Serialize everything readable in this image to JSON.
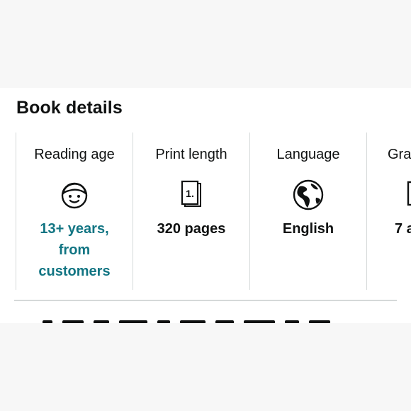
{
  "section": {
    "title": "Book details"
  },
  "details": [
    {
      "label": "Reading age",
      "icon": "child-face-icon",
      "value": "13+ years, from customers",
      "value_link": true
    },
    {
      "label": "Print length",
      "icon": "pages-icon",
      "icon_text": "1.",
      "value": "320 pages",
      "value_link": false
    },
    {
      "label": "Language",
      "icon": "globe-icon",
      "value": "English",
      "value_link": false
    },
    {
      "label": "Gra",
      "icon": "grade-icon",
      "value": "7 a",
      "value_link": false
    }
  ],
  "colors": {
    "link": "#127583",
    "text": "#0f1111",
    "border": "#d5d9d9"
  }
}
